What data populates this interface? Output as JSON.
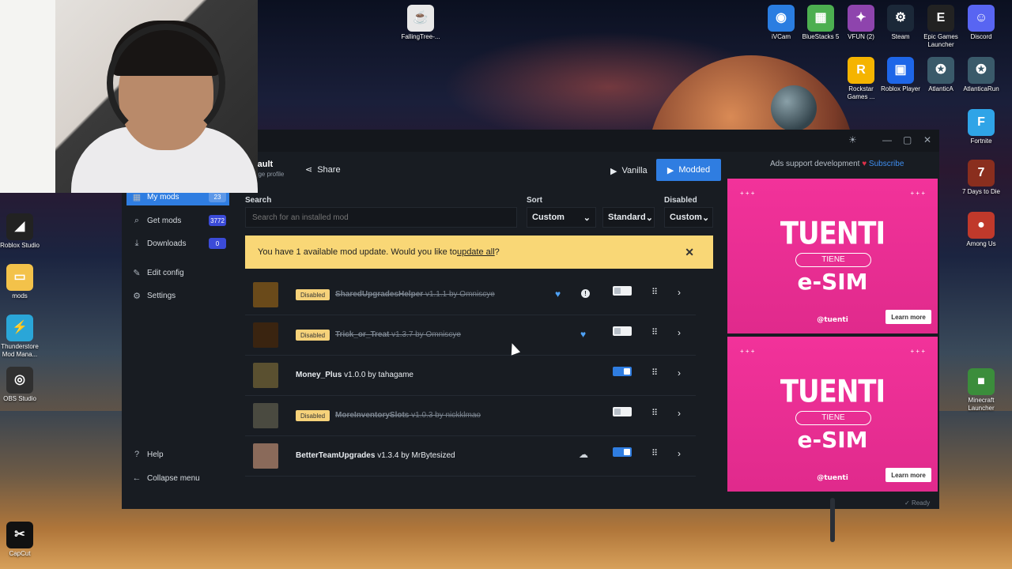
{
  "desktop": {
    "icons_right": [
      {
        "label": "iVCam",
        "glyph": "◉",
        "color": "#2a7de1"
      },
      {
        "label": "BlueStacks 5",
        "glyph": "▦",
        "color": "#4caf50"
      },
      {
        "label": "VFUN (2)",
        "glyph": "✦",
        "color": "#8e44ad"
      },
      {
        "label": "Steam",
        "glyph": "⚙",
        "color": "#1b2838"
      },
      {
        "label": "Epic Games Launcher",
        "glyph": "E",
        "color": "#222222"
      },
      {
        "label": "Discord",
        "glyph": "☺",
        "color": "#5865f2"
      },
      {
        "label": "Rockstar Games ...",
        "glyph": "R",
        "color": "#f5b400"
      },
      {
        "label": "Roblox Player",
        "glyph": "▣",
        "color": "#1e66e8"
      },
      {
        "label": "AtlanticA",
        "glyph": "✪",
        "color": "#3a5a6a"
      },
      {
        "label": "AtlanticaRun",
        "glyph": "✪",
        "color": "#3a5a6a"
      },
      {
        "label": "Fortnite",
        "glyph": "F",
        "color": "#2fa4e7"
      },
      {
        "label": "7 Days to Die",
        "glyph": "7",
        "color": "#8a2e1e"
      },
      {
        "label": "Among Us",
        "glyph": "●",
        "color": "#c0392b"
      },
      {
        "label": "Minecraft Launcher",
        "glyph": "■",
        "color": "#3b8d3b"
      }
    ],
    "icons_top": [
      {
        "label": "FallingTree-...",
        "glyph": "☕",
        "color": "#e8e8e8"
      }
    ],
    "icons_left": [
      {
        "label": "Roblox Studio",
        "glyph": "◢",
        "color": "#222222"
      },
      {
        "label": "mods",
        "glyph": "▭",
        "color": "#f3c24a"
      },
      {
        "label": "Thunderstore Mod Mana...",
        "glyph": "⚡",
        "color": "#2aa6d8"
      },
      {
        "label": "OBS Studio",
        "glyph": "◎",
        "color": "#303030"
      },
      {
        "label": "CapCut",
        "glyph": "✂",
        "color": "#111111"
      }
    ]
  },
  "app": {
    "profile_name": "fault",
    "profile_sub": "nge profile",
    "share_label": "Share",
    "vanilla_label": "Vanilla",
    "modded_label": "Modded",
    "sidebar": [
      {
        "label": "My mods",
        "badge": "23",
        "icon": "▦",
        "active": true
      },
      {
        "label": "Get mods",
        "badge": "3772",
        "icon": "⌕",
        "active": false
      },
      {
        "label": "Downloads",
        "badge": "0",
        "icon": "⤓",
        "active": false
      },
      {
        "label": "Edit config",
        "badge": "",
        "icon": "✎",
        "active": false
      },
      {
        "label": "Settings",
        "badge": "",
        "icon": "⚙",
        "active": false
      }
    ],
    "help_label": "Help",
    "collapse_label": "Collapse menu",
    "search_label": "Search",
    "search_placeholder": "Search for an installed mod",
    "sort_label": "Sort",
    "sort_value": "Custom",
    "sort_order": "Standard",
    "disabled_label": "Disabled",
    "disabled_value": "Custom",
    "banner_text": "You have 1 available mod update. Would you like to ",
    "banner_link": "update all",
    "banner_after": "?",
    "banner_close": "✕",
    "disabled_badge": "Disabled",
    "mods": [
      {
        "name": "SharedUpgradesHelper",
        "version": "v1.1.1 by Omniscye",
        "disabled": true,
        "heart": true,
        "info": true,
        "cloud": false,
        "enabled": false,
        "thumb": "#6a4a1a"
      },
      {
        "name": "Trick_or_Treat",
        "version": "v1.3.7 by Omniscye",
        "disabled": true,
        "heart": true,
        "info": false,
        "cloud": false,
        "enabled": false,
        "thumb": "#3a2410"
      },
      {
        "name": "Money_Plus",
        "version": "v1.0.0 by tahagame",
        "disabled": false,
        "heart": false,
        "info": false,
        "cloud": false,
        "enabled": true,
        "thumb": "#5a5030"
      },
      {
        "name": "MoreInventorySlots",
        "version": "v1.0.3 by nickklmao",
        "disabled": true,
        "heart": false,
        "info": false,
        "cloud": false,
        "enabled": false,
        "thumb": "#4a4a40"
      },
      {
        "name": "BetterTeamUpgrades",
        "version": "v1.3.4 by MrBytesized",
        "disabled": false,
        "heart": false,
        "info": false,
        "cloud": true,
        "enabled": true,
        "thumb": "#8a6a5a"
      }
    ],
    "status_text": "Ready"
  },
  "ads": {
    "note": "Ads support development",
    "subscribe": "Subscribe",
    "items": [
      {
        "brand": "TUENTI",
        "tiene": "TIENE",
        "esim": "e-SIM",
        "logo": "@tuenti",
        "learn": "Learn more"
      },
      {
        "brand": "TUENTI",
        "tiene": "TIENE",
        "esim": "e-SIM",
        "logo": "@tuenti",
        "learn": "Learn more"
      }
    ]
  },
  "colors": {
    "accent": "#2f7de1",
    "banner": "#f9d776",
    "ad": "#ee2f96"
  }
}
